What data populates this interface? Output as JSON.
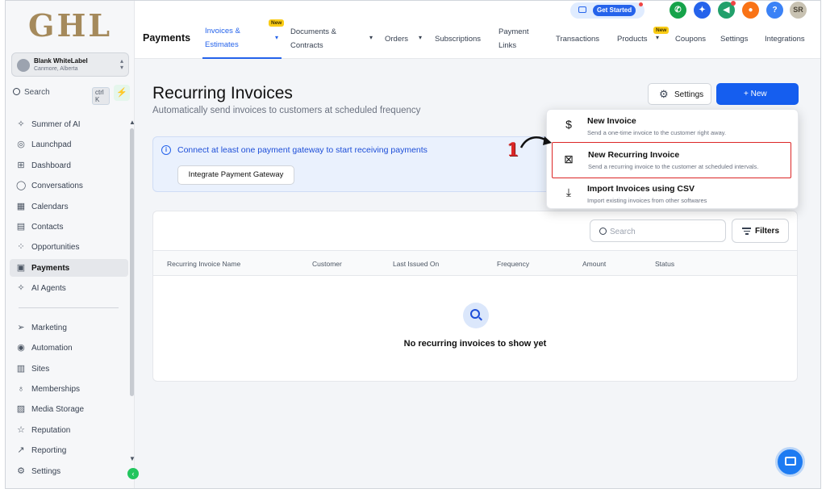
{
  "brand": {
    "logo_text": "GHL"
  },
  "account": {
    "name": "Blank WhiteLabel",
    "location": "Canmore, Alberta"
  },
  "search": {
    "label": "Search",
    "shortcut": "ctrl K"
  },
  "sidebar": {
    "items": [
      {
        "label": "Summer of AI",
        "icon": "sparkles-icon"
      },
      {
        "label": "Launchpad",
        "icon": "rocket-icon"
      },
      {
        "label": "Dashboard",
        "icon": "grid-icon"
      },
      {
        "label": "Conversations",
        "icon": "chat-icon"
      },
      {
        "label": "Calendars",
        "icon": "calendar-icon"
      },
      {
        "label": "Contacts",
        "icon": "contact-card-icon"
      },
      {
        "label": "Opportunities",
        "icon": "opportunities-icon"
      },
      {
        "label": "Payments",
        "icon": "receipt-icon"
      },
      {
        "label": "AI Agents",
        "icon": "sparkles-icon"
      }
    ],
    "items2": [
      {
        "label": "Marketing",
        "icon": "send-icon"
      },
      {
        "label": "Automation",
        "icon": "automation-icon"
      },
      {
        "label": "Sites",
        "icon": "sites-icon"
      },
      {
        "label": "Memberships",
        "icon": "membership-icon"
      },
      {
        "label": "Media Storage",
        "icon": "image-icon"
      },
      {
        "label": "Reputation",
        "icon": "star-icon"
      },
      {
        "label": "Reporting",
        "icon": "trend-icon"
      },
      {
        "label": "Settings",
        "icon": "gear-icon"
      }
    ]
  },
  "topbar": {
    "page_title": "Payments",
    "tabs": [
      {
        "line1": "Invoices &",
        "line2": "Estimates"
      },
      {
        "line1": "Documents &",
        "line2": "Contracts"
      },
      {
        "label": "Orders"
      },
      {
        "label": "Subscriptions"
      },
      {
        "line1": "Payment",
        "line2": "Links"
      },
      {
        "label": "Transactions"
      },
      {
        "label": "Products"
      },
      {
        "label": "Coupons"
      },
      {
        "label": "Settings"
      },
      {
        "label": "Integrations"
      }
    ],
    "new_badge": "New",
    "get_started": "Get Started",
    "avatar_initials": "SR",
    "help": "?"
  },
  "main": {
    "title": "Recurring Invoices",
    "subtitle": "Automatically send invoices to customers at scheduled frequency",
    "settings_label": "Settings",
    "new_label": "+ New",
    "banner_text": "Connect at least one payment gateway to start receiving payments",
    "banner_button": "Integrate Payment Gateway",
    "search_placeholder": "Search",
    "filters_label": "Filters",
    "columns": [
      "Recurring Invoice Name",
      "Customer",
      "Last Issued On",
      "Frequency",
      "Amount",
      "Status"
    ],
    "empty_text": "No recurring invoices to show yet"
  },
  "menu": {
    "items": [
      {
        "title": "New Invoice",
        "desc": "Send a one-time invoice to the customer right away.",
        "icon": "dollar-icon"
      },
      {
        "title": "New Recurring Invoice",
        "desc": "Send a recurring invoice to the customer at scheduled intervals.",
        "icon": "recurring-invoice-icon"
      },
      {
        "title": "Import Invoices using CSV",
        "desc": "Import existing invoices from other softwares",
        "icon": "download-icon"
      }
    ]
  },
  "annotation": {
    "step_number": "1"
  },
  "colors": {
    "primary": "#155eef",
    "highlight": "#dc2626",
    "logo": "#a58a5c"
  }
}
